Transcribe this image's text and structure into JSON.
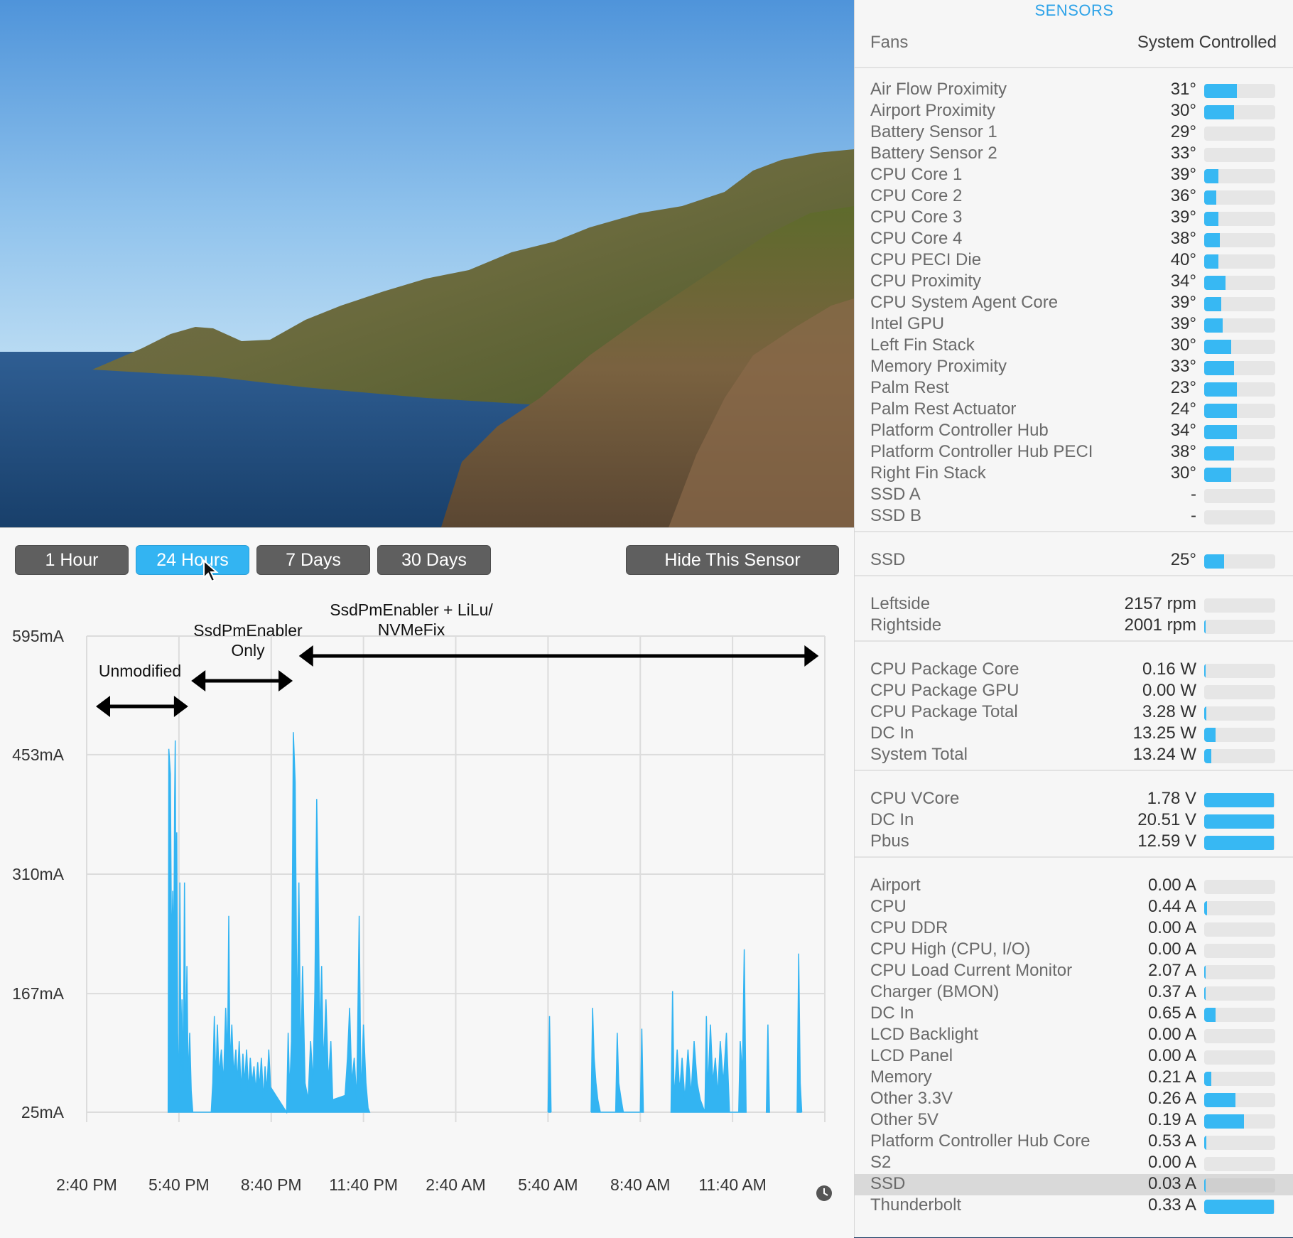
{
  "sensor_panel": {
    "title": "SENSORS",
    "fans": {
      "label": "Fans",
      "value": "System Controlled"
    },
    "groups": [
      {
        "rows": [
          {
            "name": "Air Flow Proximity",
            "value": "31°",
            "level": 0.46
          },
          {
            "name": "Airport Proximity",
            "value": "30°",
            "level": 0.42
          },
          {
            "name": "Battery Sensor 1",
            "value": "29°",
            "level": 0
          },
          {
            "name": "Battery Sensor 2",
            "value": "33°",
            "level": 0
          },
          {
            "name": "CPU Core 1",
            "value": "39°",
            "level": 0.2
          },
          {
            "name": "CPU Core 2",
            "value": "36°",
            "level": 0.17
          },
          {
            "name": "CPU Core 3",
            "value": "39°",
            "level": 0.2
          },
          {
            "name": "CPU Core 4",
            "value": "38°",
            "level": 0.22
          },
          {
            "name": "CPU PECI Die",
            "value": "40°",
            "level": 0.2
          },
          {
            "name": "CPU Proximity",
            "value": "34°",
            "level": 0.3
          },
          {
            "name": "CPU System Agent Core",
            "value": "39°",
            "level": 0.24
          },
          {
            "name": "Intel GPU",
            "value": "39°",
            "level": 0.26
          },
          {
            "name": "Left Fin Stack",
            "value": "30°",
            "level": 0.38
          },
          {
            "name": "Memory Proximity",
            "value": "33°",
            "level": 0.42
          },
          {
            "name": "Palm Rest",
            "value": "23°",
            "level": 0.46
          },
          {
            "name": "Palm Rest Actuator",
            "value": "24°",
            "level": 0.46
          },
          {
            "name": "Platform Controller Hub",
            "value": "34°",
            "level": 0.46
          },
          {
            "name": "Platform Controller Hub PECI",
            "value": "38°",
            "level": 0.42
          },
          {
            "name": "Right Fin Stack",
            "value": "30°",
            "level": 0.38
          },
          {
            "name": "SSD A",
            "value": "-",
            "level": 0
          },
          {
            "name": "SSD B",
            "value": "-",
            "level": 0
          }
        ]
      },
      {
        "rows": [
          {
            "name": "SSD",
            "value": "25°",
            "level": 0.28
          }
        ]
      },
      {
        "rows": [
          {
            "name": "Leftside",
            "value": "2157 rpm",
            "level": 0
          },
          {
            "name": "Rightside",
            "value": "2001 rpm",
            "level": 0.02
          }
        ]
      },
      {
        "rows": [
          {
            "name": "CPU Package Core",
            "value": "0.16 W",
            "level": 0.02
          },
          {
            "name": "CPU Package GPU",
            "value": "0.00 W",
            "level": 0
          },
          {
            "name": "CPU Package Total",
            "value": "3.28 W",
            "level": 0.03
          },
          {
            "name": "DC In",
            "value": "13.25 W",
            "level": 0.16
          },
          {
            "name": "System Total",
            "value": "13.24 W",
            "level": 0.1
          }
        ]
      },
      {
        "rows": [
          {
            "name": "CPU VCore",
            "value": "1.78 V",
            "level": 0.98
          },
          {
            "name": "DC In",
            "value": "20.51 V",
            "level": 0.98
          },
          {
            "name": "Pbus",
            "value": "12.59 V",
            "level": 0.98
          }
        ]
      },
      {
        "rows": [
          {
            "name": "Airport",
            "value": "0.00 A",
            "level": 0
          },
          {
            "name": "CPU",
            "value": "0.44 A",
            "level": 0.04
          },
          {
            "name": "CPU DDR",
            "value": "0.00 A",
            "level": 0
          },
          {
            "name": "CPU High (CPU, I/O)",
            "value": "0.00 A",
            "level": 0
          },
          {
            "name": "CPU Load Current Monitor",
            "value": "2.07 A",
            "level": 0.02
          },
          {
            "name": "Charger (BMON)",
            "value": "0.37 A",
            "level": 0.02
          },
          {
            "name": "DC In",
            "value": "0.65 A",
            "level": 0.16
          },
          {
            "name": "LCD Backlight",
            "value": "0.00 A",
            "level": 0
          },
          {
            "name": "LCD Panel",
            "value": "0.00 A",
            "level": 0
          },
          {
            "name": "Memory",
            "value": "0.21 A",
            "level": 0.1
          },
          {
            "name": "Other 3.3V",
            "value": "0.26 A",
            "level": 0.44
          },
          {
            "name": "Other 5V",
            "value": "0.19 A",
            "level": 0.56
          },
          {
            "name": "Platform Controller Hub Core",
            "value": "0.53 A",
            "level": 0.03
          },
          {
            "name": "S2",
            "value": "0.00 A",
            "level": 0
          },
          {
            "name": "SSD",
            "value": "0.03 A",
            "level": 0.02,
            "selected": true
          },
          {
            "name": "Thunderbolt",
            "value": "0.33 A",
            "level": 0.98
          }
        ]
      }
    ]
  },
  "chart_window": {
    "buttons": [
      {
        "id": "1h",
        "label": "1 Hour",
        "active": false
      },
      {
        "id": "24h",
        "label": "24 Hours",
        "active": true
      },
      {
        "id": "7d",
        "label": "7 Days",
        "active": false
      },
      {
        "id": "30d",
        "label": "30 Days",
        "active": false
      }
    ],
    "hide_button": "Hide This Sensor",
    "clock_icon": "clock-icon",
    "accent_color": "#33b4f2"
  },
  "chart_data": {
    "type": "area",
    "title": "",
    "xlabel": "",
    "ylabel": "",
    "y_tick_labels": [
      "595mA",
      "453mA",
      "310mA",
      "167mA",
      "25mA"
    ],
    "y_ticks": [
      595,
      453,
      310,
      167,
      25
    ],
    "ylim": [
      25,
      595
    ],
    "x_tick_labels": [
      "2:40 PM",
      "5:40 PM",
      "8:40 PM",
      "11:40 PM",
      "2:40 AM",
      "5:40 AM",
      "8:40 AM",
      "11:40 AM"
    ],
    "x_hours": [
      0,
      3,
      6,
      9,
      12,
      15,
      18,
      21
    ],
    "xlim_hours": [
      0,
      24
    ],
    "grid": true,
    "series": [
      {
        "color": "#33b4f2",
        "points": [
          [
            2.65,
            25
          ],
          [
            2.67,
            460
          ],
          [
            2.72,
            430
          ],
          [
            2.76,
            210
          ],
          [
            2.8,
            290
          ],
          [
            2.83,
            180
          ],
          [
            2.86,
            400
          ],
          [
            2.88,
            470
          ],
          [
            2.9,
            250
          ],
          [
            2.93,
            360
          ],
          [
            2.96,
            120
          ],
          [
            3.0,
            40
          ],
          [
            3.03,
            300
          ],
          [
            3.07,
            80
          ],
          [
            3.1,
            160
          ],
          [
            3.14,
            60
          ],
          [
            3.18,
            300
          ],
          [
            3.22,
            90
          ],
          [
            3.26,
            200
          ],
          [
            3.3,
            60
          ],
          [
            3.35,
            120
          ],
          [
            3.4,
            50
          ],
          [
            3.45,
            25
          ],
          [
            4.05,
            25
          ],
          [
            4.1,
            60
          ],
          [
            4.15,
            140
          ],
          [
            4.2,
            60
          ],
          [
            4.25,
            130
          ],
          [
            4.3,
            70
          ],
          [
            4.38,
            100
          ],
          [
            4.45,
            60
          ],
          [
            4.52,
            150
          ],
          [
            4.58,
            90
          ],
          [
            4.62,
            260
          ],
          [
            4.66,
            80
          ],
          [
            4.72,
            130
          ],
          [
            4.78,
            70
          ],
          [
            4.85,
            100
          ],
          [
            4.9,
            60
          ],
          [
            4.96,
            110
          ],
          [
            5.02,
            50
          ],
          [
            5.08,
            95
          ],
          [
            5.14,
            60
          ],
          [
            5.2,
            100
          ],
          [
            5.26,
            50
          ],
          [
            5.32,
            90
          ],
          [
            5.38,
            60
          ],
          [
            5.44,
            80
          ],
          [
            5.5,
            50
          ],
          [
            5.56,
            85
          ],
          [
            5.62,
            55
          ],
          [
            5.68,
            90
          ],
          [
            5.75,
            40
          ],
          [
            5.8,
            80
          ],
          [
            5.86,
            50
          ],
          [
            5.92,
            100
          ],
          [
            5.98,
            55
          ],
          [
            6.5,
            25
          ],
          [
            6.55,
            120
          ],
          [
            6.6,
            50
          ],
          [
            6.66,
            110
          ],
          [
            6.72,
            480
          ],
          [
            6.78,
            420
          ],
          [
            6.84,
            120
          ],
          [
            6.9,
            300
          ],
          [
            6.96,
            80
          ],
          [
            7.02,
            200
          ],
          [
            7.1,
            60
          ],
          [
            7.2,
            40
          ],
          [
            7.28,
            110
          ],
          [
            7.36,
            60
          ],
          [
            7.42,
            170
          ],
          [
            7.48,
            400
          ],
          [
            7.52,
            300
          ],
          [
            7.58,
            110
          ],
          [
            7.64,
            200
          ],
          [
            7.7,
            80
          ],
          [
            7.78,
            160
          ],
          [
            7.86,
            60
          ],
          [
            7.94,
            110
          ],
          [
            8.0,
            40
          ],
          [
            8.4,
            45
          ],
          [
            8.48,
            90
          ],
          [
            8.55,
            150
          ],
          [
            8.62,
            60
          ],
          [
            8.7,
            90
          ],
          [
            8.78,
            40
          ],
          [
            8.86,
            260
          ],
          [
            8.92,
            40
          ],
          [
            9.0,
            130
          ],
          [
            9.08,
            60
          ],
          [
            9.15,
            30
          ],
          [
            9.2,
            25
          ],
          [
            15.0,
            25
          ],
          [
            15.05,
            140
          ],
          [
            15.1,
            25
          ],
          [
            16.4,
            25
          ],
          [
            16.45,
            150
          ],
          [
            16.5,
            90
          ],
          [
            16.56,
            60
          ],
          [
            16.62,
            40
          ],
          [
            16.7,
            25
          ],
          [
            17.2,
            25
          ],
          [
            17.25,
            120
          ],
          [
            17.3,
            60
          ],
          [
            17.38,
            40
          ],
          [
            17.45,
            25
          ],
          [
            18.0,
            25
          ],
          [
            18.05,
            125
          ],
          [
            18.1,
            25
          ],
          [
            19.0,
            25
          ],
          [
            19.05,
            170
          ],
          [
            19.1,
            40
          ],
          [
            19.2,
            100
          ],
          [
            19.28,
            50
          ],
          [
            19.36,
            90
          ],
          [
            19.45,
            40
          ],
          [
            19.55,
            100
          ],
          [
            19.65,
            45
          ],
          [
            19.75,
            110
          ],
          [
            19.85,
            60
          ],
          [
            19.95,
            40
          ],
          [
            20.1,
            25
          ],
          [
            20.15,
            140
          ],
          [
            20.2,
            50
          ],
          [
            20.28,
            130
          ],
          [
            20.36,
            60
          ],
          [
            20.44,
            90
          ],
          [
            20.52,
            45
          ],
          [
            20.6,
            110
          ],
          [
            20.7,
            60
          ],
          [
            20.8,
            120
          ],
          [
            20.9,
            25
          ],
          [
            21.2,
            25
          ],
          [
            21.25,
            110
          ],
          [
            21.32,
            70
          ],
          [
            21.38,
            220
          ],
          [
            21.44,
            25
          ],
          [
            22.1,
            25
          ],
          [
            22.15,
            130
          ],
          [
            22.2,
            25
          ],
          [
            23.1,
            25
          ],
          [
            23.15,
            215
          ],
          [
            23.2,
            60
          ],
          [
            23.25,
            25
          ]
        ]
      }
    ],
    "annotations": [
      {
        "text": "Unmodified",
        "from_hour": 0.3,
        "to_hour": 3.3
      },
      {
        "text": "SsdPmEnabler Only",
        "from_hour": 3.4,
        "to_hour": 6.7
      },
      {
        "text": "SsdPmEnabler + LiLu/ NVMeFix",
        "from_hour": 6.9,
        "to_hour": 23.8
      }
    ]
  }
}
